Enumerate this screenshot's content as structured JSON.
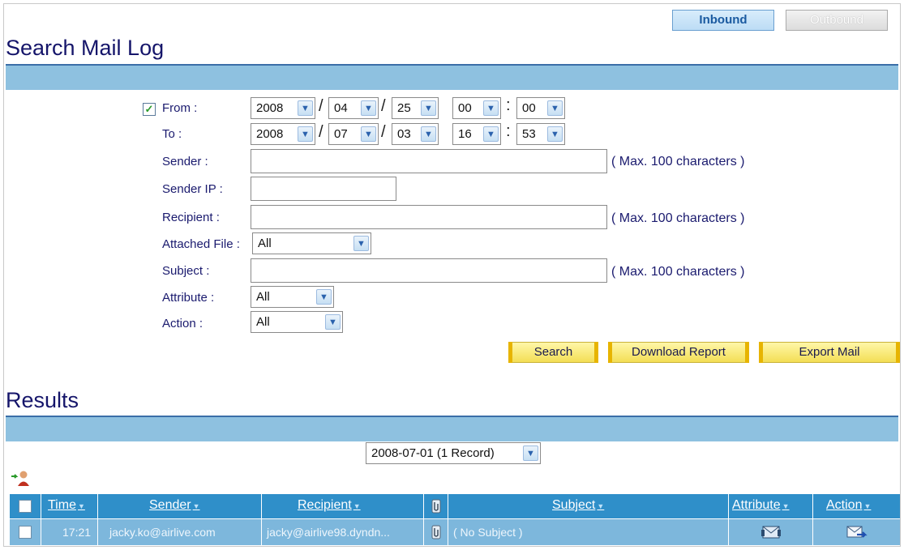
{
  "tabs": {
    "inbound": "Inbound",
    "outbound": "Outbound"
  },
  "search": {
    "title": "Search Mail Log",
    "from_label": "From :",
    "to_label": "To :",
    "from": {
      "year": "2008",
      "month": "04",
      "day": "25",
      "hour": "00",
      "minute": "00"
    },
    "to": {
      "year": "2008",
      "month": "07",
      "day": "03",
      "hour": "16",
      "minute": "53"
    },
    "date_sep": "/",
    "time_sep": ":",
    "sender_label": "Sender :",
    "sender_ip_label": "Sender IP :",
    "recipient_label": "Recipient :",
    "attached_file_label": "Attached File :",
    "attached_file_value": "All",
    "subject_label": "Subject :",
    "attribute_label": "Attribute :",
    "attribute_value": "All",
    "action_label": "Action :",
    "action_value": "All",
    "max_hint": "( Max. 100 characters )",
    "buttons": {
      "search": "Search",
      "download": "Download Report",
      "export": "Export Mail"
    }
  },
  "results": {
    "title": "Results",
    "date_filter": "2008-07-01 (1 Record)",
    "columns": {
      "time": "Time",
      "sender": "Sender",
      "recipient": "Recipient",
      "subject": "Subject",
      "attribute": "Attribute",
      "action": "Action"
    },
    "rows": [
      {
        "time": "17:21",
        "sender": "jacky.ko@airlive.com",
        "recipient": "jacky@airlive98.dyndn...",
        "subject": "( No Subject )"
      }
    ]
  },
  "colors": {
    "band": "#8ec1e0",
    "header": "#2f8fc9",
    "row": "#7db7dc",
    "button": "#f3de55"
  }
}
